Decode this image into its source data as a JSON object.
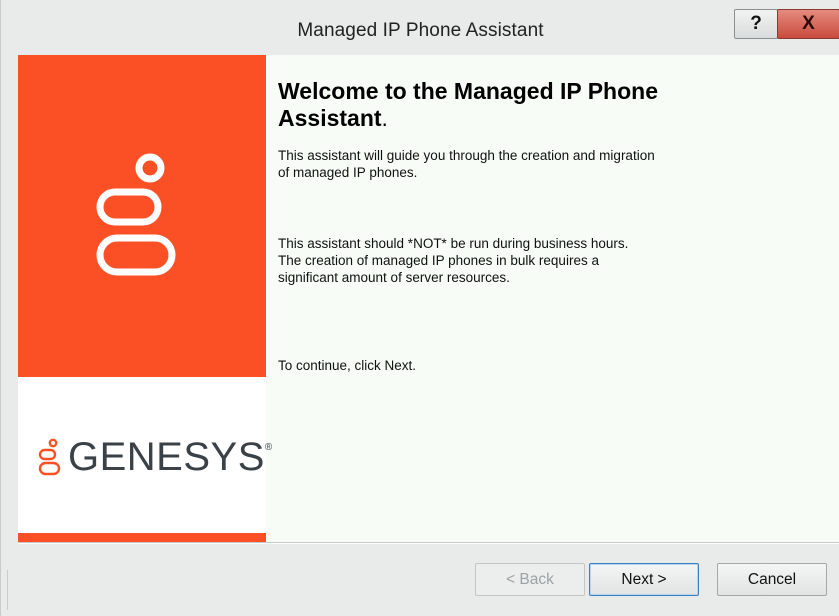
{
  "window": {
    "title": "Managed IP Phone Assistant",
    "help_label": "?",
    "close_label": "X"
  },
  "sidebar": {
    "brand_name": "GENESYS",
    "trademark": "®",
    "accent_color": "#fb5026",
    "logo_icon": "genesys-logo-icon"
  },
  "main": {
    "heading_line1": "Welcome to the Managed IP Phone",
    "heading_line2": "Assistant",
    "heading_period": ".",
    "paragraph1_line1": "This assistant will guide you through the creation and migration",
    "paragraph1_line2": "of managed IP phones.",
    "paragraph2_line1": "This assistant should *NOT* be run during business hours.",
    "paragraph2_line2": "The creation of managed IP phones in bulk requires a",
    "paragraph2_line3": "significant amount of server resources.",
    "paragraph3": "To continue, click Next."
  },
  "footer": {
    "back_label": "< Back",
    "next_label": "Next >",
    "cancel_label": "Cancel"
  }
}
